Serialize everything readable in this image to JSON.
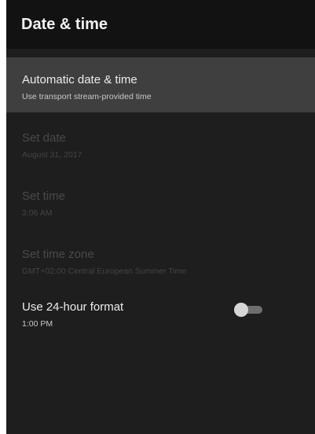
{
  "header": {
    "title": "Date & time"
  },
  "settings": [
    {
      "label": "Automatic date & time",
      "subtitle": "Use transport stream-provided time",
      "state": "focused"
    },
    {
      "label": "Set date",
      "subtitle": "August 31, 2017",
      "state": "disabled"
    },
    {
      "label": "Set time",
      "subtitle": "3:06 AM",
      "state": "disabled"
    },
    {
      "label": "Set time zone",
      "subtitle": "GMT+02:00 Central European Summer Time",
      "state": "disabled"
    },
    {
      "label": "Use 24-hour format",
      "subtitle": "1:00 PM",
      "state": "enabled",
      "toggle_on": false
    }
  ],
  "colors": {
    "background": "#1e1e1e",
    "header_background": "#121212",
    "focus_highlight": "#3f3f3f"
  }
}
